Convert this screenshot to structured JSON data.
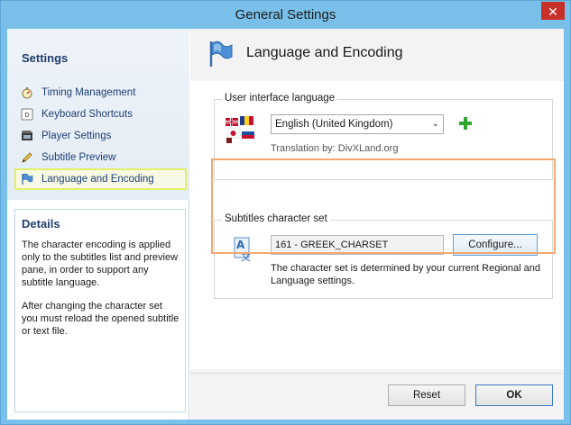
{
  "window": {
    "title": "General Settings",
    "close_glyph": "✕"
  },
  "sidebar": {
    "heading": "Settings",
    "items": [
      {
        "label": "Timing Management",
        "icon": "stopwatch-icon"
      },
      {
        "label": "Keyboard Shortcuts",
        "icon": "keyboard-key-icon"
      },
      {
        "label": "Player Settings",
        "icon": "film-player-icon"
      },
      {
        "label": "Subtitle Preview",
        "icon": "pencil-icon"
      },
      {
        "label": "Language and Encoding",
        "icon": "flag-icon",
        "selected": true
      }
    ]
  },
  "details": {
    "title": "Details",
    "paragraph1": "The character encoding is applied only to the subtitles list and preview pane, in order to support any subtitle language.",
    "paragraph2": "After changing the character set you must reload the opened subtitle or text file."
  },
  "page": {
    "title": "Language and Encoding",
    "ui_language": {
      "group_label": "User interface language",
      "selected_value": "English (United Kingdom)",
      "translation_credit": "Translation by: DivXLand.org"
    },
    "charset": {
      "group_label": "Subtitles character set",
      "value": "161 - GREEK_CHARSET",
      "configure_label": "Configure...",
      "note": "The character set is determined by your current Regional and Language settings."
    }
  },
  "footer": {
    "reset_label": "Reset",
    "ok_label": "OK"
  },
  "colors": {
    "title_bar": "#78c0ea",
    "close_button": "#c7312a",
    "selection_highlight": "#e3f06a",
    "group_highlight": "#f2a872",
    "add_icon": "#2fa52f"
  }
}
